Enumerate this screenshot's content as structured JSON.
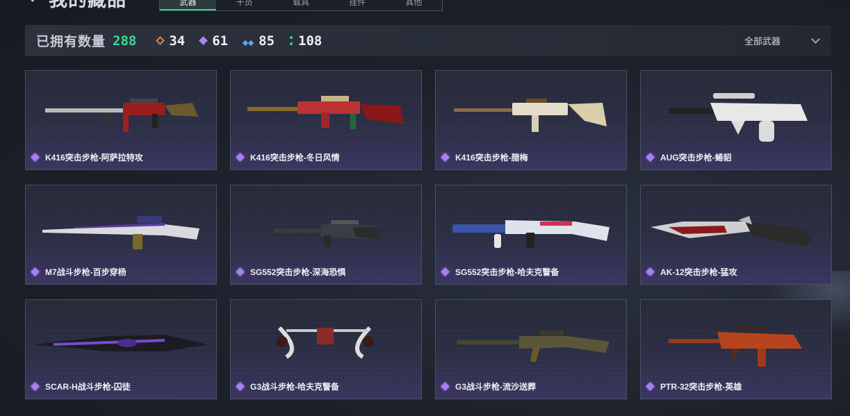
{
  "header": {
    "title": "我的藏品",
    "tabs": [
      "武器",
      "干员",
      "载具",
      "挂件",
      "其他"
    ]
  },
  "stats": {
    "owned_label": "已拥有数量",
    "owned_count": "288",
    "rarities": [
      {
        "icon": "orange-diamond-icon",
        "count": "34",
        "color": "#d88a4a"
      },
      {
        "icon": "purple-diamond-icon",
        "count": "61",
        "color": "#a884f0"
      },
      {
        "icon": "blue-double-diamond-icon",
        "count": "85",
        "color": "#5ea4e6"
      },
      {
        "icon": "green-dots-icon",
        "count": "108",
        "color": "#35d2a0"
      }
    ],
    "filter_label": "全部武器"
  },
  "items": [
    {
      "name": "K416突击步枪-阿萨拉特攻"
    },
    {
      "name": "K416突击步枪-冬日风情"
    },
    {
      "name": "K416突击步枪-腊梅"
    },
    {
      "name": "AUG突击步枪-蜷貂"
    },
    {
      "name": "M7战斗步枪-百步穿杨"
    },
    {
      "name": "SG552突击步枪-深海恐惧"
    },
    {
      "name": "SG552突击步枪-哈夫克警备"
    },
    {
      "name": "AK-12突击步枪-猛攻"
    },
    {
      "name": "SCAR-H战斗步枪-囚徒"
    },
    {
      "name": "G3战斗步枪-哈夫克警备"
    },
    {
      "name": "G3战斗步枪-流沙送葬"
    },
    {
      "name": "PTR-32突击步枪-英雄"
    }
  ]
}
